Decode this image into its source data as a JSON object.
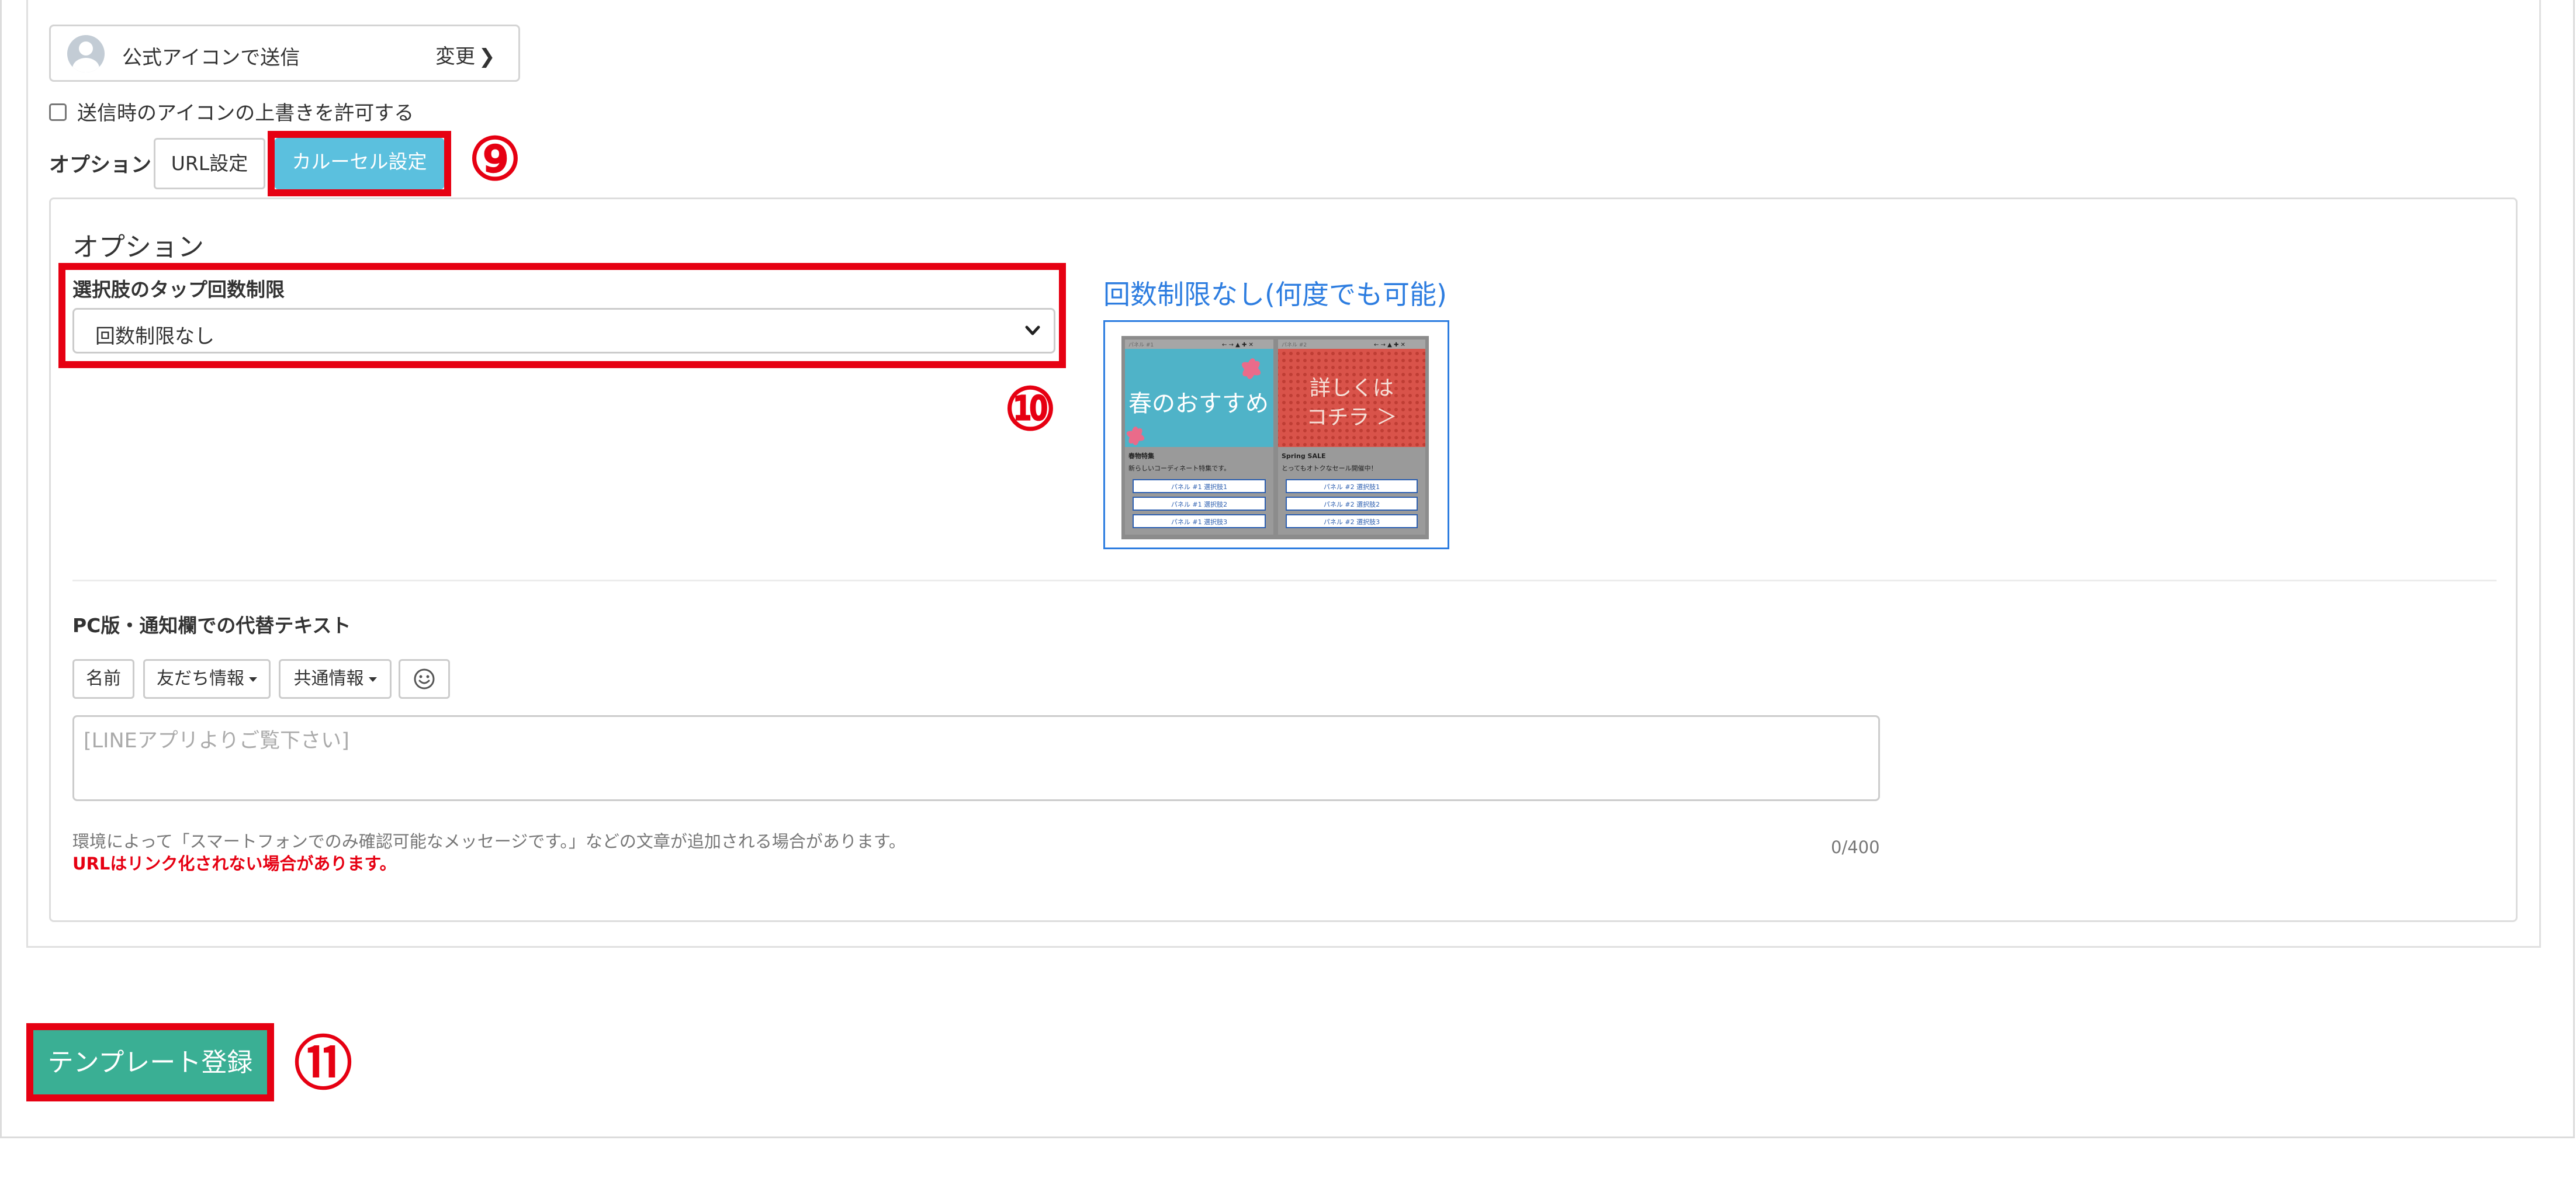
{
  "sender": {
    "label": "公式アイコンで送信",
    "change_label": "変更",
    "change_chevron": "❯"
  },
  "overwrite": {
    "label": "送信時のアイコンの上書きを許可する",
    "checked": false
  },
  "options_row": {
    "label": "オプション",
    "tabs": [
      {
        "label": "URL設定",
        "active": false
      },
      {
        "label": "カルーセル設定",
        "active": true
      }
    ]
  },
  "options_card": {
    "heading": "オプション",
    "tap_limit": {
      "label": "選択肢のタップ回数制限",
      "value": "回数制限なし"
    },
    "preview": {
      "title": "回数制限なし(何度でも可能)",
      "panels": [
        {
          "image_text": "春のおすすめ",
          "name": "春物特集",
          "description": "新らしいコーディネート特集です。",
          "choices": [
            "パネル #1 選択肢1",
            "パネル #1 選択肢2",
            "パネル #1 選択肢3"
          ]
        },
        {
          "image_text_line1": "詳しくは",
          "image_text_line2": "コチラ ＞",
          "name": "Spring SALE",
          "description": "とってもオトクなセール開催中！",
          "choices": [
            "パネル #2 選択肢1",
            "パネル #2 選択肢2",
            "パネル #2 選択肢3"
          ]
        }
      ]
    },
    "alt_text": {
      "label": "PC版・通知欄での代替テキスト",
      "buttons": [
        {
          "label": "名前"
        },
        {
          "label": "友だち情報"
        },
        {
          "label": "共通情報"
        }
      ],
      "emoji_icon": "smiley-icon",
      "placeholder": "[LINEアプリよりご覧下さい]",
      "value": "",
      "notice": "環境によって「スマートフォンでのみ確認可能なメッセージです。」などの文章が追加される場合があります。",
      "warning": "URLはリンク化されない場合があります。",
      "char_count": "0/400"
    }
  },
  "submit": {
    "label": "テンプレート登録"
  },
  "annotations": {
    "marker_9": "⑨",
    "marker_10": "⑩",
    "marker_11": "⑪",
    "color": "#e60012"
  },
  "colors": {
    "primary_button": "#3aaf94",
    "info_button": "#5bc0de",
    "preview_accent": "#2d7de0",
    "warning_text": "#e60012",
    "panel_blue": "#4fb3c8",
    "panel_red": "#d9534a"
  }
}
